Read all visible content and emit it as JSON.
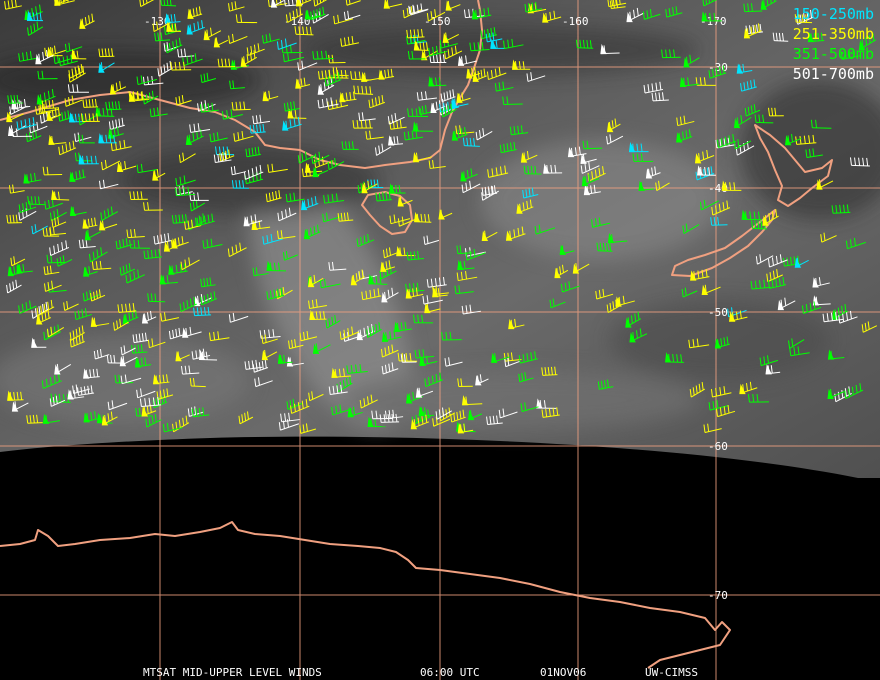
{
  "map": {
    "longitude_labels": [
      "-130",
      "-140",
      "-150",
      "-160",
      "-170"
    ],
    "latitude_labels": [
      "-30",
      "-40",
      "-50",
      "-60",
      "-70"
    ]
  },
  "legend": [
    {
      "label": "150-250mb",
      "color": "#00e5ff"
    },
    {
      "label": "251-350mb",
      "color": "#ffff00"
    },
    {
      "label": "351-500mb",
      "color": "#00ff00"
    },
    {
      "label": "501-700mb",
      "color": "#ffffff"
    }
  ],
  "footer": {
    "product": "MTSAT MID-UPPER LEVEL WINDS",
    "time": "06:00 UTC",
    "date": "01NOV06",
    "source": "UW-CIMSS"
  },
  "colors": {
    "coastline": "#f0a080",
    "gridline": "#f0a080",
    "space": "#000000"
  }
}
